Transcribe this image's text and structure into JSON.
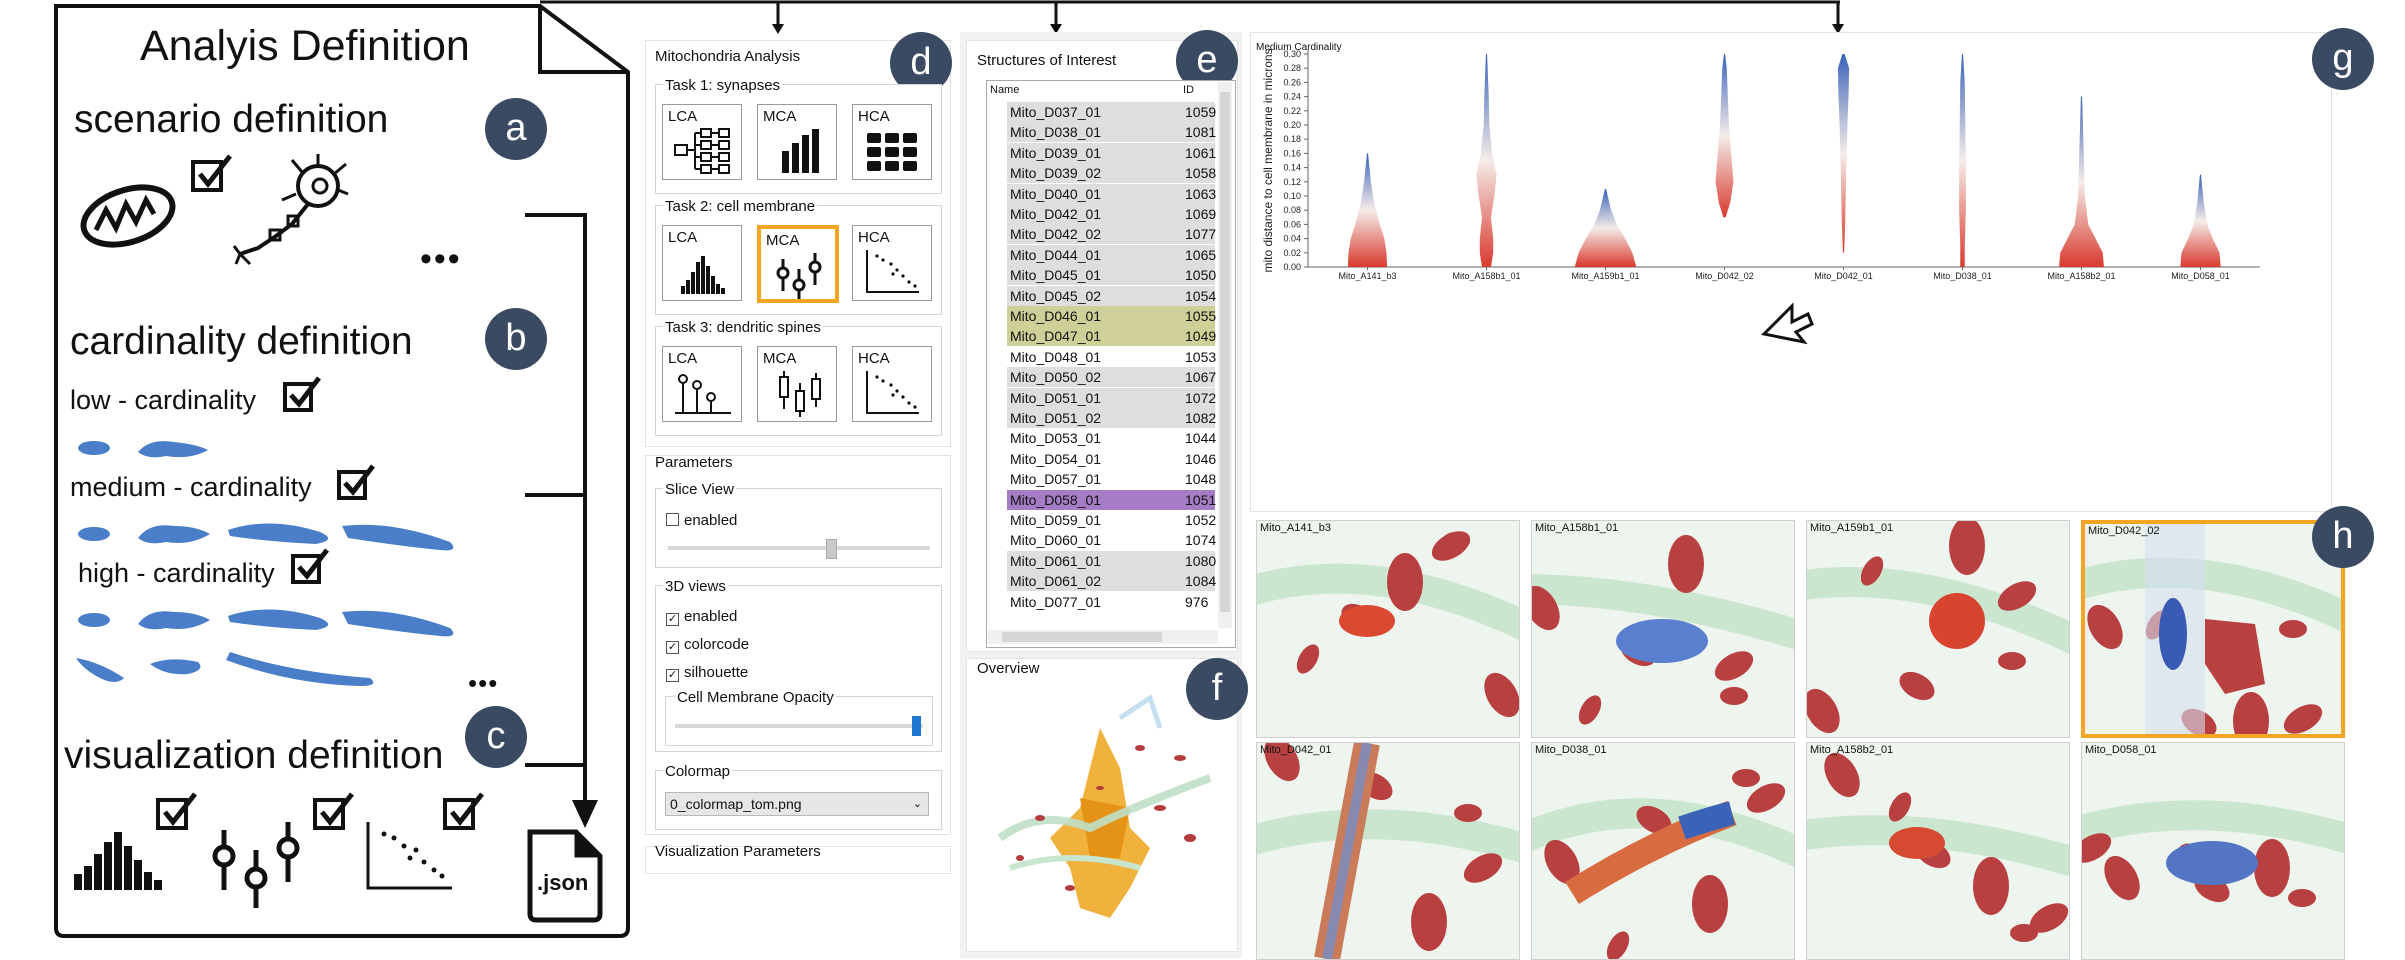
{
  "analysis": {
    "title": "Analyis Definition",
    "scenario": "scenario definition",
    "cardinality": "cardinality definition",
    "low": "low - cardinality",
    "medium": "medium - cardinality",
    "high": "high - cardinality",
    "visualization": "visualization definition",
    "ellipsis": "•••",
    "json_label": ".json"
  },
  "badges": [
    "a",
    "b",
    "c",
    "d",
    "e",
    "f",
    "g",
    "h"
  ],
  "mito_panel": {
    "title": "Mitochondria Analysis",
    "task1": "Task 1: synapses",
    "task2": "Task 2: cell membrane",
    "task3": "Task 3: dendritic spines",
    "lca": "LCA",
    "mca": "MCA",
    "hca": "HCA"
  },
  "parameters": {
    "title": "Parameters",
    "slice_view": "Slice View",
    "enabled": "enabled",
    "views_3d": "3D views",
    "colorcode": "colorcode",
    "silhouette": "silhouette",
    "opacity": "Cell Membrane Opacity",
    "colormap": "Colormap",
    "colormap_value": "0_colormap_tom.png",
    "vis_params": "Visualization Parameters",
    "slider_slice": 0.62,
    "slider_opacity": 0.98
  },
  "structures": {
    "title": "Structures of Interest",
    "col_name": "Name",
    "col_id": "ID",
    "rows": [
      {
        "name": "Mito_D037_01",
        "id": "1059",
        "hl": "grey"
      },
      {
        "name": "Mito_D038_01",
        "id": "1081",
        "hl": "grey"
      },
      {
        "name": "Mito_D039_01",
        "id": "1061",
        "hl": "grey"
      },
      {
        "name": "Mito_D039_02",
        "id": "1058",
        "hl": "grey"
      },
      {
        "name": "Mito_D040_01",
        "id": "1063",
        "hl": "grey"
      },
      {
        "name": "Mito_D042_01",
        "id": "1069",
        "hl": "grey"
      },
      {
        "name": "Mito_D042_02",
        "id": "1077",
        "hl": "grey"
      },
      {
        "name": "Mito_D044_01",
        "id": "1065",
        "hl": "grey"
      },
      {
        "name": "Mito_D045_01",
        "id": "1050",
        "hl": "grey"
      },
      {
        "name": "Mito_D045_02",
        "id": "1054",
        "hl": "grey"
      },
      {
        "name": "Mito_D046_01",
        "id": "1055",
        "hl": "olive"
      },
      {
        "name": "Mito_D047_01",
        "id": "1049",
        "hl": "olive"
      },
      {
        "name": "Mito_D048_01",
        "id": "1053",
        "hl": "none"
      },
      {
        "name": "Mito_D050_02",
        "id": "1067",
        "hl": "grey"
      },
      {
        "name": "Mito_D051_01",
        "id": "1072",
        "hl": "grey"
      },
      {
        "name": "Mito_D051_02",
        "id": "1082",
        "hl": "grey"
      },
      {
        "name": "Mito_D053_01",
        "id": "1044",
        "hl": "none"
      },
      {
        "name": "Mito_D054_01",
        "id": "1046",
        "hl": "none"
      },
      {
        "name": "Mito_D057_01",
        "id": "1048",
        "hl": "none"
      },
      {
        "name": "Mito_D058_01",
        "id": "1051",
        "hl": "purple"
      },
      {
        "name": "Mito_D059_01",
        "id": "1052",
        "hl": "none"
      },
      {
        "name": "Mito_D060_01",
        "id": "1074",
        "hl": "none"
      },
      {
        "name": "Mito_D061_01",
        "id": "1080",
        "hl": "grey"
      },
      {
        "name": "Mito_D061_02",
        "id": "1084",
        "hl": "grey"
      },
      {
        "name": "Mito_D077_01",
        "id": "976",
        "hl": "none"
      }
    ]
  },
  "overview": {
    "title": "Overview"
  },
  "chart_data": {
    "type": "violin",
    "title": "Medium Cardinality",
    "xlabel": "",
    "ylabel": "mito distance to cell membrane in microns",
    "ylim": [
      0,
      0.3
    ],
    "yticks": [
      "0.00",
      "0.02",
      "0.04",
      "0.06",
      "0.08",
      "0.10",
      "0.12",
      "0.14",
      "0.16",
      "0.18",
      "0.20",
      "0.22",
      "0.24",
      "0.26",
      "0.28",
      "0.30"
    ],
    "categories": [
      "Mito_A141_b3",
      "Mito_A158b1_01",
      "Mito_A159b1_01",
      "Mito_D042_02",
      "Mito_D042_01",
      "Mito_D038_01",
      "Mito_A158b2_01",
      "Mito_D058_01"
    ],
    "max": [
      0.16,
      0.3,
      0.11,
      0.3,
      0.3,
      0.3,
      0.24,
      0.13
    ],
    "colors": {
      "low": "#d93a2e",
      "mid": "#f5ece8",
      "high": "#3a63b8"
    }
  },
  "thumbnails": [
    "Mito_A141_b3",
    "Mito_A158b1_01",
    "Mito_A159b1_01",
    "Mito_D042_02",
    "Mito_D042_01",
    "Mito_D038_01",
    "Mito_A158b2_01",
    "Mito_D058_01"
  ]
}
